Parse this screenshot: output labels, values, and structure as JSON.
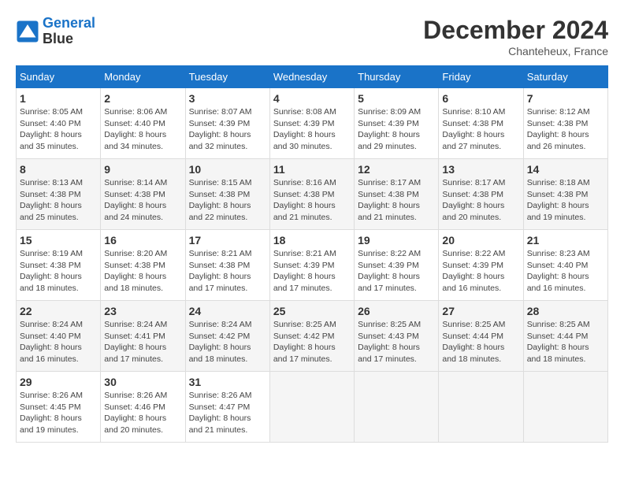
{
  "header": {
    "logo_line1": "General",
    "logo_line2": "Blue",
    "month_year": "December 2024",
    "location": "Chanteheux, France"
  },
  "days_of_week": [
    "Sunday",
    "Monday",
    "Tuesday",
    "Wednesday",
    "Thursday",
    "Friday",
    "Saturday"
  ],
  "weeks": [
    [
      {
        "day": "1",
        "sunrise": "8:05 AM",
        "sunset": "4:40 PM",
        "daylight": "8 hours and 35 minutes."
      },
      {
        "day": "2",
        "sunrise": "8:06 AM",
        "sunset": "4:40 PM",
        "daylight": "8 hours and 34 minutes."
      },
      {
        "day": "3",
        "sunrise": "8:07 AM",
        "sunset": "4:39 PM",
        "daylight": "8 hours and 32 minutes."
      },
      {
        "day": "4",
        "sunrise": "8:08 AM",
        "sunset": "4:39 PM",
        "daylight": "8 hours and 30 minutes."
      },
      {
        "day": "5",
        "sunrise": "8:09 AM",
        "sunset": "4:39 PM",
        "daylight": "8 hours and 29 minutes."
      },
      {
        "day": "6",
        "sunrise": "8:10 AM",
        "sunset": "4:38 PM",
        "daylight": "8 hours and 27 minutes."
      },
      {
        "day": "7",
        "sunrise": "8:12 AM",
        "sunset": "4:38 PM",
        "daylight": "8 hours and 26 minutes."
      }
    ],
    [
      {
        "day": "8",
        "sunrise": "8:13 AM",
        "sunset": "4:38 PM",
        "daylight": "8 hours and 25 minutes."
      },
      {
        "day": "9",
        "sunrise": "8:14 AM",
        "sunset": "4:38 PM",
        "daylight": "8 hours and 24 minutes."
      },
      {
        "day": "10",
        "sunrise": "8:15 AM",
        "sunset": "4:38 PM",
        "daylight": "8 hours and 22 minutes."
      },
      {
        "day": "11",
        "sunrise": "8:16 AM",
        "sunset": "4:38 PM",
        "daylight": "8 hours and 21 minutes."
      },
      {
        "day": "12",
        "sunrise": "8:17 AM",
        "sunset": "4:38 PM",
        "daylight": "8 hours and 21 minutes."
      },
      {
        "day": "13",
        "sunrise": "8:17 AM",
        "sunset": "4:38 PM",
        "daylight": "8 hours and 20 minutes."
      },
      {
        "day": "14",
        "sunrise": "8:18 AM",
        "sunset": "4:38 PM",
        "daylight": "8 hours and 19 minutes."
      }
    ],
    [
      {
        "day": "15",
        "sunrise": "8:19 AM",
        "sunset": "4:38 PM",
        "daylight": "8 hours and 18 minutes."
      },
      {
        "day": "16",
        "sunrise": "8:20 AM",
        "sunset": "4:38 PM",
        "daylight": "8 hours and 18 minutes."
      },
      {
        "day": "17",
        "sunrise": "8:21 AM",
        "sunset": "4:38 PM",
        "daylight": "8 hours and 17 minutes."
      },
      {
        "day": "18",
        "sunrise": "8:21 AM",
        "sunset": "4:39 PM",
        "daylight": "8 hours and 17 minutes."
      },
      {
        "day": "19",
        "sunrise": "8:22 AM",
        "sunset": "4:39 PM",
        "daylight": "8 hours and 17 minutes."
      },
      {
        "day": "20",
        "sunrise": "8:22 AM",
        "sunset": "4:39 PM",
        "daylight": "8 hours and 16 minutes."
      },
      {
        "day": "21",
        "sunrise": "8:23 AM",
        "sunset": "4:40 PM",
        "daylight": "8 hours and 16 minutes."
      }
    ],
    [
      {
        "day": "22",
        "sunrise": "8:24 AM",
        "sunset": "4:40 PM",
        "daylight": "8 hours and 16 minutes."
      },
      {
        "day": "23",
        "sunrise": "8:24 AM",
        "sunset": "4:41 PM",
        "daylight": "8 hours and 17 minutes."
      },
      {
        "day": "24",
        "sunrise": "8:24 AM",
        "sunset": "4:42 PM",
        "daylight": "8 hours and 18 minutes."
      },
      {
        "day": "25",
        "sunrise": "8:25 AM",
        "sunset": "4:42 PM",
        "daylight": "8 hours and 17 minutes."
      },
      {
        "day": "26",
        "sunrise": "8:25 AM",
        "sunset": "4:43 PM",
        "daylight": "8 hours and 17 minutes."
      },
      {
        "day": "27",
        "sunrise": "8:25 AM",
        "sunset": "4:44 PM",
        "daylight": "8 hours and 18 minutes."
      },
      {
        "day": "28",
        "sunrise": "8:25 AM",
        "sunset": "4:44 PM",
        "daylight": "8 hours and 18 minutes."
      }
    ],
    [
      {
        "day": "29",
        "sunrise": "8:26 AM",
        "sunset": "4:45 PM",
        "daylight": "8 hours and 19 minutes."
      },
      {
        "day": "30",
        "sunrise": "8:26 AM",
        "sunset": "4:46 PM",
        "daylight": "8 hours and 20 minutes."
      },
      {
        "day": "31",
        "sunrise": "8:26 AM",
        "sunset": "4:47 PM",
        "daylight": "8 hours and 21 minutes."
      },
      null,
      null,
      null,
      null
    ]
  ]
}
